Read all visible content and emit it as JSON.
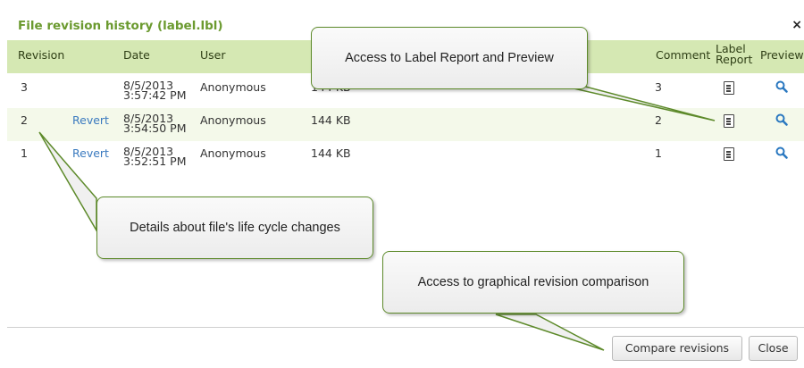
{
  "dialog": {
    "title": "File revision history (label.lbl)",
    "close_glyph": "×"
  },
  "table": {
    "headers": {
      "revision": "Revision",
      "date": "Date",
      "user": "User",
      "comment": "Comment",
      "label_report_1": "Label",
      "label_report_2": "Report",
      "preview": "Preview"
    },
    "rows": [
      {
        "revision": "3",
        "revert": "",
        "date1": "8/5/2013",
        "date2": "3:57:42 PM",
        "user": "Anonymous",
        "size": "144 KB",
        "comment": "3"
      },
      {
        "revision": "2",
        "revert": "Revert",
        "date1": "8/5/2013",
        "date2": "3:54:50 PM",
        "user": "Anonymous",
        "size": "144 KB",
        "comment": "2"
      },
      {
        "revision": "1",
        "revert": "Revert",
        "date1": "8/5/2013",
        "date2": "3:52:51 PM",
        "user": "Anonymous",
        "size": "144 KB",
        "comment": "1"
      }
    ]
  },
  "buttons": {
    "compare": "Compare revisions",
    "close": "Close"
  },
  "callouts": {
    "report": "Access to Label Report and Preview",
    "details": "Details about file's life cycle changes",
    "compare": "Access to graphical revision comparison"
  },
  "icons": {
    "report": "document-icon",
    "preview": "magnifier-icon",
    "close": "close-icon"
  },
  "colors": {
    "title": "#6b9a2f",
    "header_bg": "#d5e8b3",
    "alt_row_bg": "#f4f9ea",
    "link": "#3a7abf",
    "callout_border": "#5d8a2a"
  }
}
